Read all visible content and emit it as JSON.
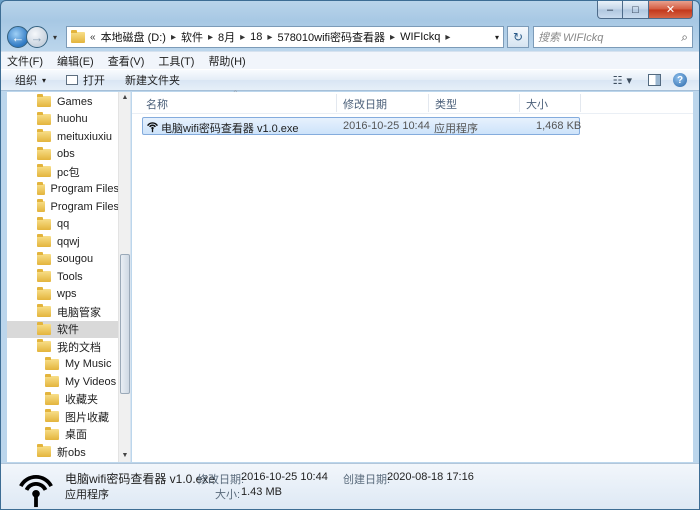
{
  "window": {
    "caption": {
      "minimize": "–",
      "maximize": "□",
      "close": "✕"
    }
  },
  "address": {
    "root_marker": "«",
    "crumbs": [
      "本地磁盘 (D:)",
      "软件",
      "8月",
      "18",
      "578010wifi密码查看器",
      "WIFIckq"
    ],
    "separator": "▸",
    "dropdown": "▾",
    "refresh": "↻",
    "search_placeholder": "搜索 WIFIckq",
    "search_icon": "⌕"
  },
  "nav": {
    "back": "←",
    "forward": "→",
    "history_dropdown": "▾"
  },
  "menu": [
    "文件(F)",
    "编辑(E)",
    "查看(V)",
    "工具(T)",
    "帮助(H)"
  ],
  "toolbar": {
    "organize": "组织",
    "organize_caret": "▾",
    "open": "打开",
    "new_folder": "新建文件夹",
    "views_icon": "☷",
    "views_caret": "▾",
    "help": "?"
  },
  "tree": [
    {
      "label": "Games",
      "indent": false,
      "selected": false
    },
    {
      "label": "huohu",
      "indent": false,
      "selected": false
    },
    {
      "label": "meituxiuxiu",
      "indent": false,
      "selected": false
    },
    {
      "label": "obs",
      "indent": false,
      "selected": false
    },
    {
      "label": "pc包",
      "indent": false,
      "selected": false
    },
    {
      "label": "Program Files",
      "indent": false,
      "selected": false
    },
    {
      "label": "Program Files",
      "indent": false,
      "selected": false
    },
    {
      "label": "qq",
      "indent": false,
      "selected": false
    },
    {
      "label": "qqwj",
      "indent": false,
      "selected": false
    },
    {
      "label": "sougou",
      "indent": false,
      "selected": false
    },
    {
      "label": "Tools",
      "indent": false,
      "selected": false
    },
    {
      "label": "wps",
      "indent": false,
      "selected": false
    },
    {
      "label": "电脑管家",
      "indent": false,
      "selected": false
    },
    {
      "label": "软件",
      "indent": false,
      "selected": true
    },
    {
      "label": "我的文档",
      "indent": false,
      "selected": false
    },
    {
      "label": "My Music",
      "indent": true,
      "selected": false
    },
    {
      "label": "My Videos",
      "indent": true,
      "selected": false
    },
    {
      "label": "收藏夹",
      "indent": true,
      "selected": false
    },
    {
      "label": "图片收藏",
      "indent": true,
      "selected": false
    },
    {
      "label": "桌面",
      "indent": true,
      "selected": false
    },
    {
      "label": "新obs",
      "indent": false,
      "selected": false
    }
  ],
  "scrollbar": {
    "up": "▲",
    "down": "▼"
  },
  "columns": {
    "name": "名称",
    "modified": "修改日期",
    "type": "类型",
    "size": "大小",
    "sort_caret": "⌃"
  },
  "files": [
    {
      "name": "电脑wifi密码查看器 v1.0.exe",
      "modified": "2016-10-25 10:44",
      "type": "应用程序",
      "size": "1,468 KB"
    }
  ],
  "details": {
    "name": "电脑wifi密码查看器 v1.0.exe",
    "type": "应用程序",
    "modified_label": "修改日期:",
    "modified_value": "2016-10-25 10:44",
    "created_label": "创建日期:",
    "created_value": "2020-08-18 17:16",
    "size_label": "大小:",
    "size_value": "1.43 MB"
  },
  "colors": {
    "selection": "#cde3fa",
    "selection_border": "#84acdd",
    "window_frame": "#a7c8e4"
  },
  "icons": {
    "file": "wifi-signal-icon",
    "folder": "folder-icon"
  }
}
